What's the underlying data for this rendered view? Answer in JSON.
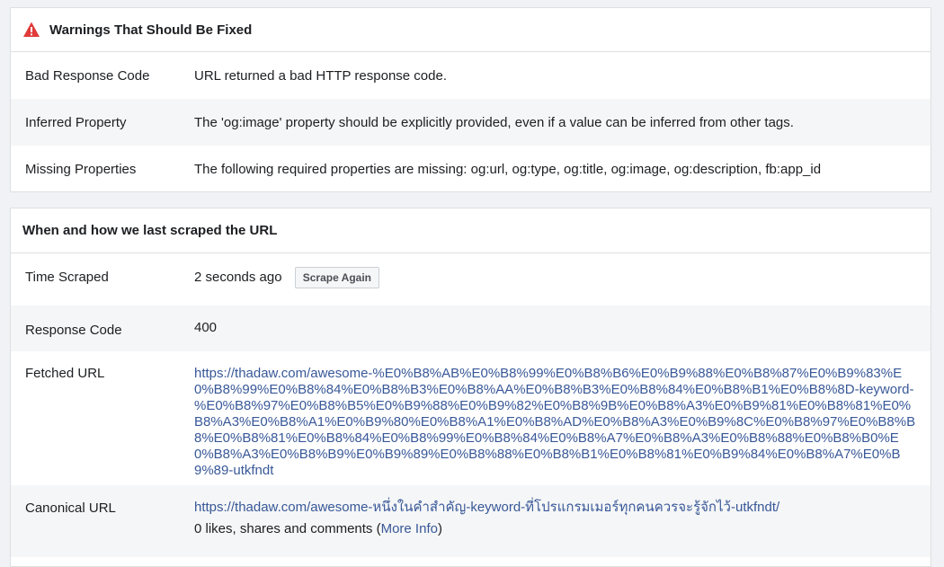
{
  "warnings": {
    "title": "Warnings That Should Be Fixed",
    "icon": "warning-triangle-icon",
    "rows": [
      {
        "label": "Bad Response Code",
        "value": "URL returned a bad HTTP response code."
      },
      {
        "label": "Inferred Property",
        "value": "The 'og:image' property should be explicitly provided, even if a value can be inferred from other tags."
      },
      {
        "label": "Missing Properties",
        "value": "The following required properties are missing: og:url, og:type, og:title, og:image, og:description, fb:app_id"
      }
    ]
  },
  "scrape": {
    "title": "When and how we last scraped the URL",
    "time_label": "Time Scraped",
    "time_value": "2 seconds ago",
    "scrape_again_button": "Scrape Again",
    "response_label": "Response Code",
    "response_value": "400",
    "fetched_label": "Fetched URL",
    "fetched_url": "https://thadaw.com/awesome-%E0%B8%AB%E0%B8%99%E0%B8%B6%E0%B9%88%E0%B8%87%E0%B9%83%E0%B8%99%E0%B8%84%E0%B8%B3%E0%B8%AA%E0%B8%B3%E0%B8%84%E0%B8%B1%E0%B8%8D-keyword-%E0%B8%97%E0%B8%B5%E0%B9%88%E0%B9%82%E0%B8%9B%E0%B8%A3%E0%B9%81%E0%B8%81%E0%B8%A3%E0%B8%A1%E0%B9%80%E0%B8%A1%E0%B8%AD%E0%B8%A3%E0%B9%8C%E0%B8%97%E0%B8%B8%E0%B8%81%E0%B8%84%E0%B8%99%E0%B8%84%E0%B8%A7%E0%B8%A3%E0%B8%88%E0%B8%B0%E0%B8%A3%E0%B8%B9%E0%B9%89%E0%B8%88%E0%B8%B1%E0%B8%81%E0%B9%84%E0%B8%A7%E0%B9%89-utkfndt",
    "canonical_label": "Canonical URL",
    "canonical_url": "https://thadaw.com/awesome-หนึ่งในคำสำคัญ-keyword-ที่โปรแกรมเมอร์ทุกคนควรจะรู้จักไว้-utkfndt/",
    "likes_text": "0 likes, shares and comments (",
    "more_info_link": "More Info",
    "likes_close": ")"
  },
  "colors": {
    "link": "#385898",
    "warning": "#e03a3a",
    "alt_row": "#f5f6f7",
    "border": "#dddfe2"
  }
}
